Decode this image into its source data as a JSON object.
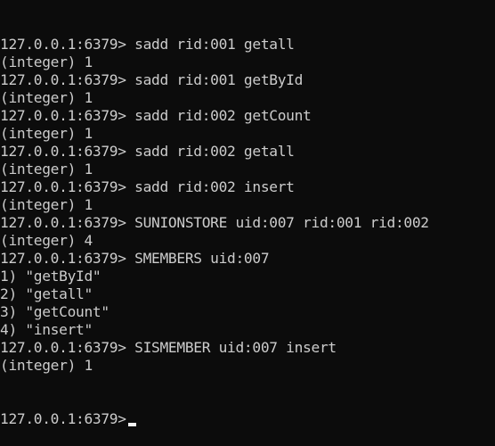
{
  "terminal": {
    "prompt": "127.0.0.1:6379>",
    "lines": [
      {
        "type": "command",
        "text": "sadd rid:001 getall"
      },
      {
        "type": "output",
        "text": "(integer) 1"
      },
      {
        "type": "command",
        "text": "sadd rid:001 getById"
      },
      {
        "type": "output",
        "text": "(integer) 1"
      },
      {
        "type": "command",
        "text": "sadd rid:002 getCount"
      },
      {
        "type": "output",
        "text": "(integer) 1"
      },
      {
        "type": "command",
        "text": "sadd rid:002 getall"
      },
      {
        "type": "output",
        "text": "(integer) 1"
      },
      {
        "type": "command",
        "text": "sadd rid:002 insert"
      },
      {
        "type": "output",
        "text": "(integer) 1"
      },
      {
        "type": "command",
        "text": "SUNIONSTORE uid:007 rid:001 rid:002"
      },
      {
        "type": "output",
        "text": "(integer) 4"
      },
      {
        "type": "command",
        "text": "SMEMBERS uid:007"
      },
      {
        "type": "output",
        "text": "1) \"getById\""
      },
      {
        "type": "output",
        "text": "2) \"getall\""
      },
      {
        "type": "output",
        "text": "3) \"getCount\""
      },
      {
        "type": "output",
        "text": "4) \"insert\""
      },
      {
        "type": "command",
        "text": "SISMEMBER uid:007 insert"
      },
      {
        "type": "output",
        "text": "(integer) 1"
      }
    ],
    "input_line": ""
  },
  "colors": {
    "background": "#0c0c0c",
    "foreground": "#cccccc",
    "cursor": "#f2f2f2"
  }
}
